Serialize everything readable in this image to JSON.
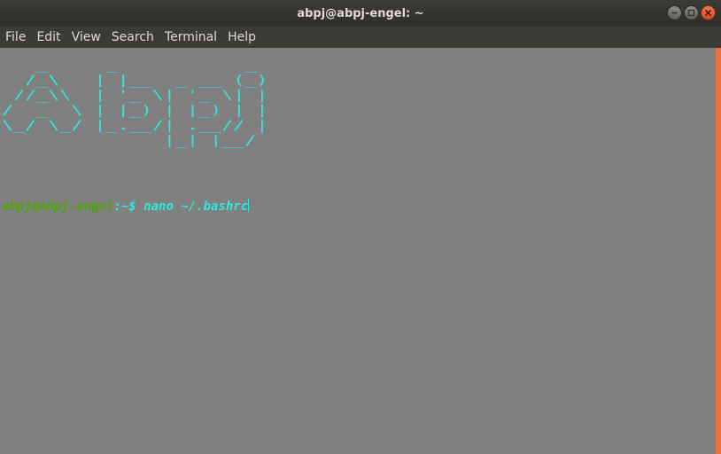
{
  "window": {
    "title": "abpj@abpj-engel: ~"
  },
  "menu": {
    "items": [
      "File",
      "Edit",
      "View",
      "Search",
      "Terminal",
      "Help"
    ]
  },
  "terminal": {
    "banner_art": "   _     _           _ \n  /_\\   | |__  _ __ (_)\n //_\\\\  | '_ \\| '_ \\| |\n/  _  \\ | |_) | |_) | |\n\\_/ \\_/ |_.__/| .__// |\n              |_| |__/ ",
    "prompt_user_host": "abpj@abpj-engel",
    "prompt_path": ":~$ ",
    "command": "nano ~/.bashrc"
  },
  "colors": {
    "titlebar": "#3c3b37",
    "terminal_bg": "#808080",
    "banner": "#2ee8dc",
    "prompt_user": "#4fa20c",
    "scrollbar": "#e96f3f",
    "close_button": "#e95420"
  },
  "icons": {
    "minimize": "minimize-icon",
    "maximize": "maximize-icon",
    "close": "close-icon"
  }
}
